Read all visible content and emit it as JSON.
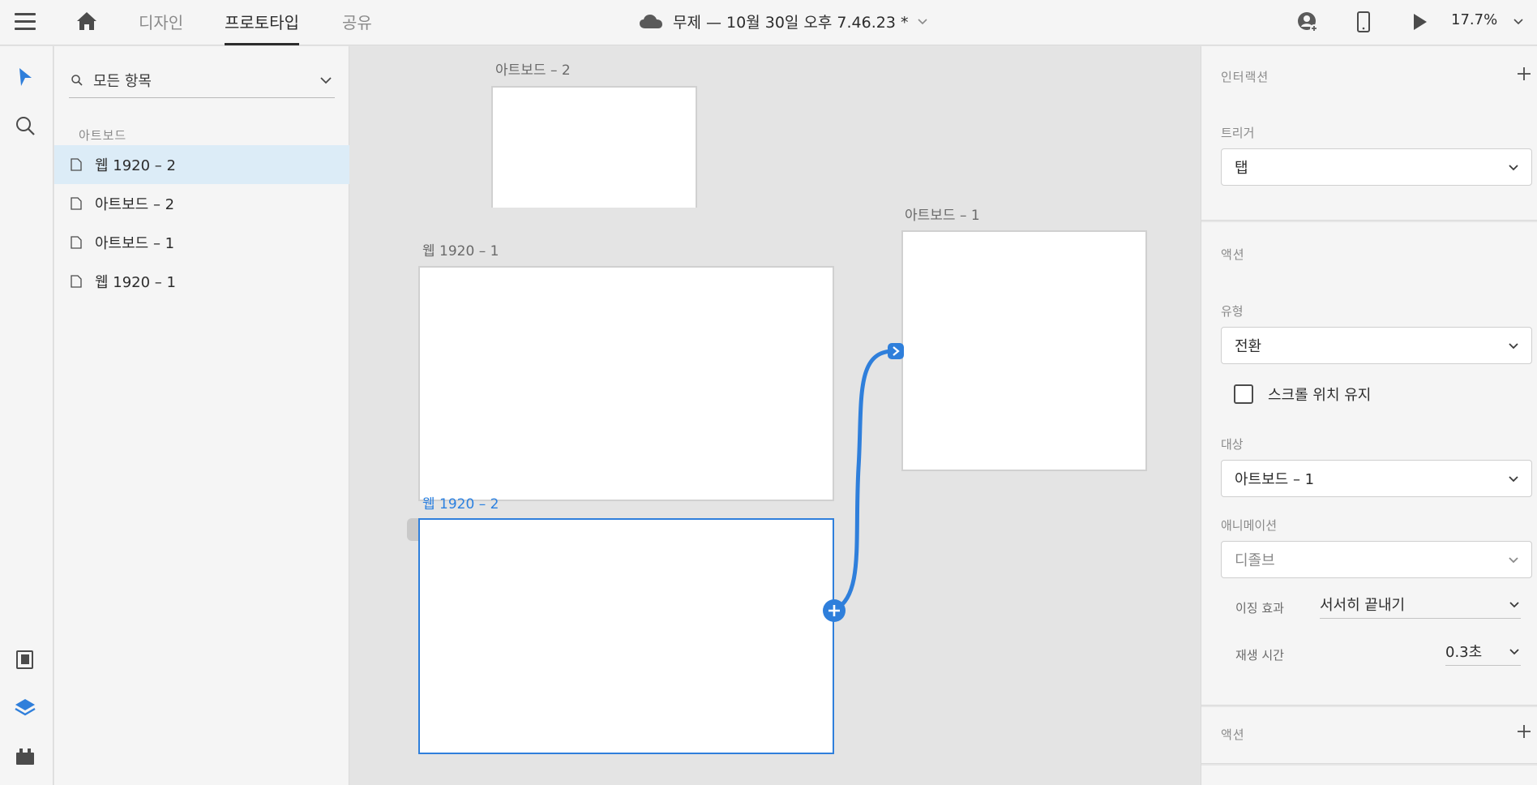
{
  "topbar": {
    "tabs": [
      {
        "label": "디자인"
      },
      {
        "label": "프로토타입"
      },
      {
        "label": "공유"
      }
    ],
    "doc_title": "무제 — 10월 30일 오후 7.46.23 *",
    "zoom": "17.7%"
  },
  "layers": {
    "search_placeholder": "모든 항목",
    "section_label": "아트보드",
    "items": [
      {
        "label": "웹 1920 – 2"
      },
      {
        "label": "아트보드 – 2"
      },
      {
        "label": "아트보드 – 1"
      },
      {
        "label": "웹 1920 – 1"
      }
    ]
  },
  "canvas": {
    "artboards": [
      {
        "label": "아트보드 – 2"
      },
      {
        "label": "웹 1920 – 1"
      },
      {
        "label": "아트보드 – 1"
      },
      {
        "label": "웹 1920 – 2"
      }
    ]
  },
  "inspector": {
    "interaction_title": "인터랙션",
    "trigger_label": "트리거",
    "trigger_value": "탭",
    "action_title": "액션",
    "type_label": "유형",
    "type_value": "전환",
    "preserve_scroll_label": "스크롤 위치 유지",
    "preserve_scroll_checked": false,
    "destination_label": "대상",
    "destination_value": "아트보드 – 1",
    "animation_label": "애니메이션",
    "animation_value": "디졸브",
    "easing_label": "이징 효과",
    "easing_value": "서서히 끝내기",
    "duration_label": "재생 시간",
    "duration_value": "0.3초",
    "action2_title": "액션"
  },
  "colors": {
    "accent": "#2f7fdb",
    "selected_row": "#dcecf7"
  },
  "icons": [
    "menu-icon",
    "home-icon",
    "cloud-icon",
    "chevron-down-icon",
    "user-share-icon",
    "mobile-preview-icon",
    "play-icon",
    "select-arrow-icon",
    "search-icon",
    "assets-icon",
    "layers-icon",
    "plugins-icon",
    "page-icon",
    "plus-icon"
  ]
}
